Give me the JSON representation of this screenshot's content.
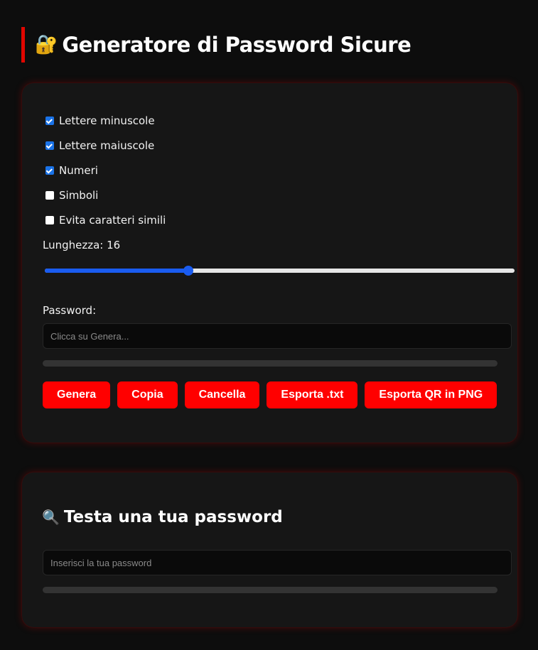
{
  "header": {
    "icon": "lock-key-icon",
    "emoji": "🔐",
    "title": "Generatore di Password Sicure"
  },
  "generator": {
    "options": [
      {
        "label": "Lettere minuscole",
        "checked": true
      },
      {
        "label": "Lettere maiuscole",
        "checked": true
      },
      {
        "label": "Numeri",
        "checked": true
      },
      {
        "label": "Simboli",
        "checked": false
      },
      {
        "label": "Evita caratteri simili",
        "checked": false
      }
    ],
    "length_label": "Lunghezza: 16",
    "length_value": 16,
    "length_slider_fraction": 0.305,
    "password_label": "Password:",
    "password_placeholder": "Clicca su Genera...",
    "strength_fraction": 0,
    "buttons": {
      "generate": "Genera",
      "copy": "Copia",
      "clear": "Cancella",
      "export_txt": "Esporta .txt",
      "export_qr": "Esporta QR in PNG"
    }
  },
  "tester": {
    "icon": "magnifier-icon",
    "emoji": "🔍",
    "title": "Testa una tua password",
    "input_placeholder": "Inserisci la tua password",
    "strength_fraction": 0
  },
  "colors": {
    "accent": "#ff0000",
    "background": "#0d0d0d",
    "card": "#161616",
    "slider": "#1a5cf0"
  }
}
